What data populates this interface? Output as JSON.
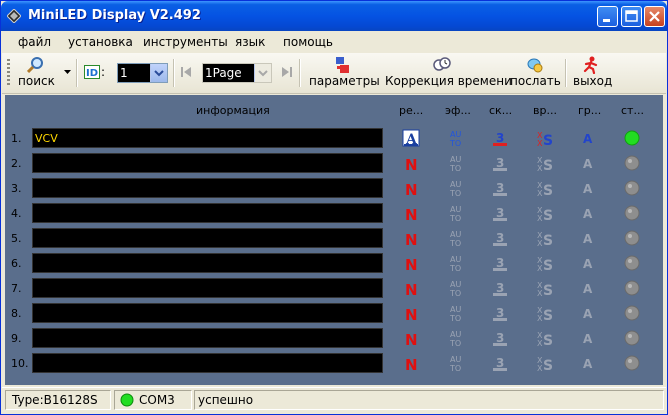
{
  "window": {
    "title": "MiniLED Display V2.492"
  },
  "menu": [
    "файл",
    "установка",
    "инструменты",
    "язык",
    "помощь"
  ],
  "toolbar": {
    "search_label": "поиск",
    "id_label": ":",
    "id_value": "1",
    "page_value": "1Page",
    "params_label": "параметры",
    "time_label": "Коррекция времени",
    "send_label": "послать",
    "exit_label": "выход"
  },
  "table": {
    "headers": {
      "info": "информация",
      "mode": "ре...",
      "effect": "эф...",
      "speed": "ск...",
      "time": "вр...",
      "border": "гр...",
      "status": "ст..."
    },
    "rows": [
      {
        "num": "1.",
        "text": "VCV",
        "active": true
      },
      {
        "num": "2.",
        "text": "",
        "active": false
      },
      {
        "num": "3.",
        "text": "",
        "active": false
      },
      {
        "num": "4.",
        "text": "",
        "active": false
      },
      {
        "num": "5.",
        "text": "",
        "active": false
      },
      {
        "num": "6.",
        "text": "",
        "active": false
      },
      {
        "num": "7.",
        "text": "",
        "active": false
      },
      {
        "num": "8.",
        "text": "",
        "active": false
      },
      {
        "num": "9.",
        "text": "",
        "active": false
      },
      {
        "num": "10.",
        "text": "",
        "active": false
      }
    ]
  },
  "status": {
    "type": "Type:B16128S",
    "port": "COM3",
    "message": "успешно"
  },
  "colors": {
    "title_blue": "#0553E3",
    "panel": "#5A6E8C",
    "led_green": "#22DD22",
    "text_yellow": "#FFD800"
  }
}
